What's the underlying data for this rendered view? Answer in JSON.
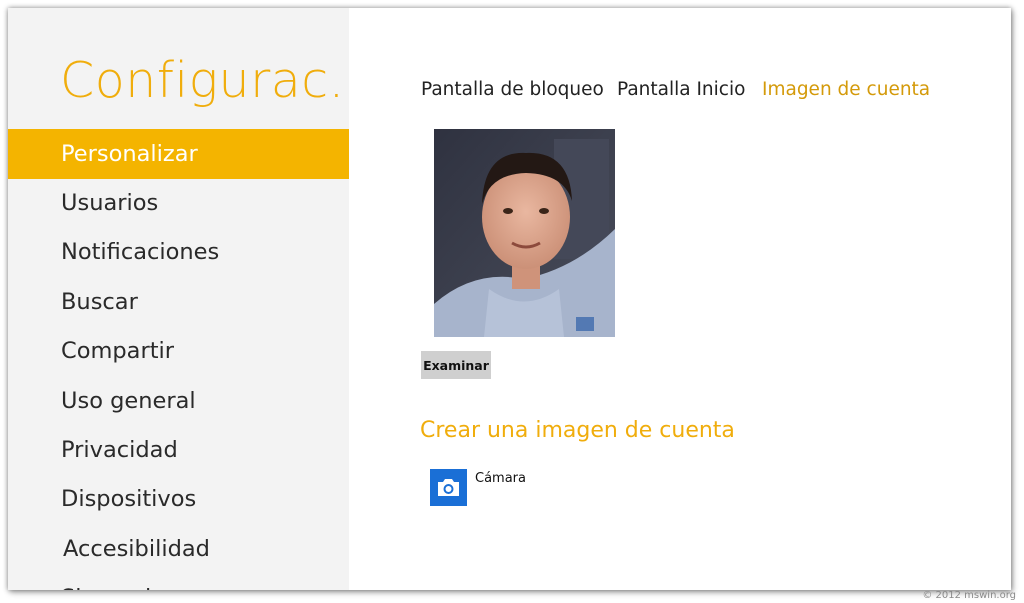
{
  "app": {
    "title": "Configurac..."
  },
  "nav": {
    "items": [
      {
        "label": "Personalizar",
        "selected": true
      },
      {
        "label": "Usuarios"
      },
      {
        "label": "Notificaciones"
      },
      {
        "label": "Buscar"
      },
      {
        "label": "Compartir"
      },
      {
        "label": "Uso general"
      },
      {
        "label": "Privacidad"
      },
      {
        "label": "Dispositivos"
      },
      {
        "label": "Accesibilidad"
      },
      {
        "label": "Sincronizar"
      }
    ]
  },
  "tabs": [
    {
      "label": "Pantalla de bloqueo"
    },
    {
      "label": "Pantalla Inicio"
    },
    {
      "label": "Imagen de cuenta",
      "active": true
    }
  ],
  "account": {
    "browse_label": "Examinar",
    "create_heading": "Crear una imagen de cuenta",
    "apps": [
      {
        "label": "Cámara",
        "icon": "camera-icon"
      }
    ]
  },
  "watermark": "© 2012 mswin.org",
  "colors": {
    "accent": "#f4b400",
    "accent_text": "#f0ad0c",
    "camera_tile": "#1a6fd6",
    "nav_bg": "#f3f3f3"
  }
}
